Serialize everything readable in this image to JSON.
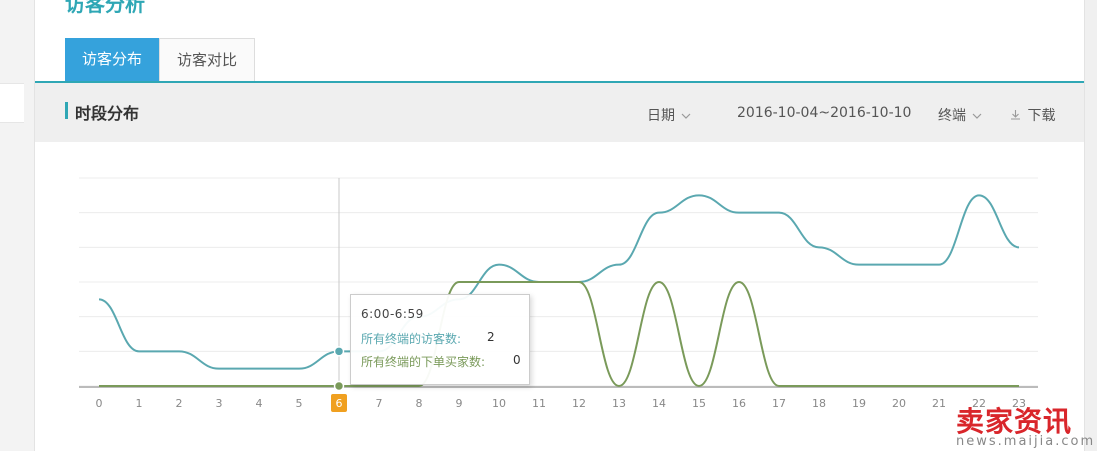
{
  "page": {
    "title": "访客分析"
  },
  "tabs": [
    {
      "label": "访客分布",
      "active": true
    },
    {
      "label": "访客对比",
      "active": false
    }
  ],
  "section": {
    "title": "时段分布",
    "filters": {
      "date_label": "日期",
      "date_range": "2016-10-04~2016-10-10",
      "terminal_label": "终端",
      "download_label": "下载"
    }
  },
  "tooltip": {
    "title": "6:00-6:59",
    "rows": [
      {
        "label": "所有终端的访客数:",
        "value": "2",
        "color": "#5aa8b0"
      },
      {
        "label": "所有终端的下单买家数:",
        "value": "0",
        "color": "#7a9a5a"
      }
    ]
  },
  "colors": {
    "accent": "#2fa7b5",
    "tab_active": "#35a2dc",
    "visitors_line": "#5aa8b0",
    "buyers_line": "#7a9a5a",
    "highlight_tick": "#f0a020"
  },
  "watermark": {
    "main": "卖家资讯",
    "sub": "news.maijia.com"
  },
  "chart_data": {
    "type": "line",
    "categories": [
      "0",
      "1",
      "2",
      "3",
      "4",
      "5",
      "6",
      "7",
      "8",
      "9",
      "10",
      "11",
      "12",
      "13",
      "14",
      "15",
      "16",
      "17",
      "18",
      "19",
      "20",
      "21",
      "22",
      "23"
    ],
    "series": [
      {
        "name": "所有终端的访客数",
        "values": [
          5,
          2,
          2,
          1,
          1,
          1,
          2,
          2,
          4,
          5,
          7,
          6,
          6,
          7,
          10,
          11,
          10,
          10,
          8,
          7,
          7,
          7,
          11,
          8
        ]
      },
      {
        "name": "所有终端的下单买家数",
        "values": [
          0,
          0,
          0,
          0,
          0,
          0,
          0,
          0,
          0,
          6,
          6,
          6,
          6,
          0,
          6,
          0,
          6,
          0,
          0,
          0,
          0,
          0,
          0,
          0
        ]
      }
    ],
    "highlight_category": "6",
    "ylim": [
      0,
      12
    ],
    "grid": true,
    "xlabel": "",
    "ylabel": ""
  }
}
